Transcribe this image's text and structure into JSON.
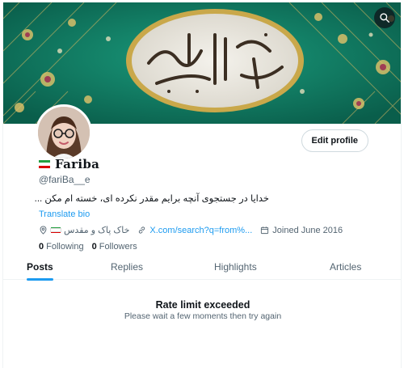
{
  "banner": {
    "calligraphy": "ابا عبدالله یا صاحب الزمان",
    "alt": ""
  },
  "search": {
    "icon": "search-icon"
  },
  "profile": {
    "display_name": "Fariba",
    "handle": "@fariBa__e",
    "bio": "خدایا در جستجوی آنچه برایم مقدر نکرده ای، خسته ام مکن ...",
    "translate_label": "Translate bio",
    "location": "خاک پاک و مقدس",
    "website": "X.com/search?q=from%...",
    "joined": "Joined June 2016",
    "following_count": "0",
    "following_label": "Following",
    "followers_count": "0",
    "followers_label": "Followers",
    "edit_label": "Edit profile"
  },
  "tabs": [
    {
      "label": "Posts",
      "active": true
    },
    {
      "label": "Replies",
      "active": false
    },
    {
      "label": "Highlights",
      "active": false
    },
    {
      "label": "Articles",
      "active": false
    }
  ],
  "empty_state": {
    "title": "Rate limit exceeded",
    "subtitle": "Please wait a few moments then try again"
  },
  "colors": {
    "accent": "#1d9bf0",
    "text": "#0f1419",
    "muted": "#536471",
    "banner_teal": "#0f7a63",
    "banner_gold": "#c9a84a",
    "flag_green": "#239f40",
    "flag_red": "#da0000"
  }
}
